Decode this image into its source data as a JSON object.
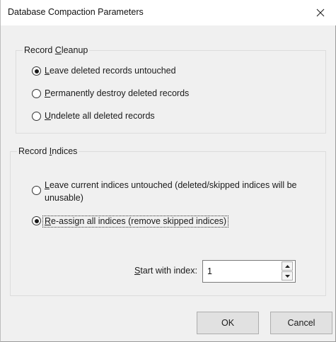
{
  "dialog": {
    "title": "Database Compaction Parameters"
  },
  "record_cleanup": {
    "legend_prefix": "Record ",
    "legend_access": "C",
    "legend_rest": "leanup",
    "options": [
      {
        "access": "L",
        "rest": "eave deleted records untouched",
        "checked": true
      },
      {
        "access": "P",
        "rest": "ermanently destroy deleted records",
        "checked": false
      },
      {
        "access": "U",
        "rest": "ndelete all deleted records",
        "checked": false
      }
    ]
  },
  "record_indices": {
    "legend_prefix": "Record ",
    "legend_access": "I",
    "legend_rest": "ndices",
    "options": [
      {
        "access": "L",
        "rest": "eave current indices untouched (deleted/skipped indices will be",
        "line2": "unusable)",
        "checked": false
      },
      {
        "access": "R",
        "rest": "e-assign all indices (remove skipped indices)",
        "checked": true
      }
    ],
    "start_label_access": "S",
    "start_label_rest": "tart with index:",
    "start_value": "1"
  },
  "buttons": {
    "ok": "OK",
    "cancel": "Cancel"
  }
}
